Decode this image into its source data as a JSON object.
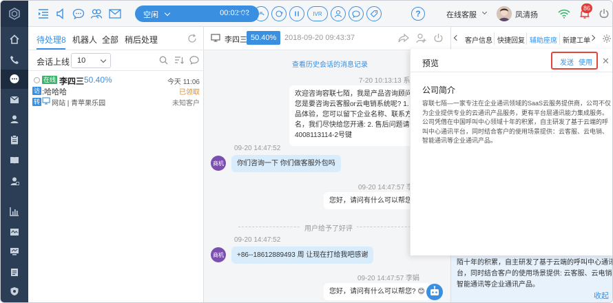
{
  "toolbar": {
    "status": "空闲",
    "timer": "00:02:02",
    "call_buttons": [
      "",
      "",
      "",
      "",
      "IVR",
      "",
      "",
      ""
    ],
    "service_mode": "在线客服",
    "user_name": "凤清扬",
    "notification_count": "86"
  },
  "left": {
    "tabs": [
      "待处理8",
      "机器人",
      "全部",
      "稍后处理"
    ],
    "filter_label": "会话上线",
    "filter_value": "10",
    "session": {
      "status_tag": "在线",
      "name": "李四三",
      "percent": "50.40%",
      "time": "今天 11:06",
      "visit_tag": "访",
      "message": ":哈哈哈",
      "claim": "已领取",
      "transfer_tag": "转",
      "source": "网站 | 青苹果乐园",
      "customer": "未知客户"
    }
  },
  "chat": {
    "name": "李四三",
    "percent": "50.40%",
    "time": "2018-09-20 09:43:37",
    "history_link": "查看历史会话的消息记录",
    "msg1_time": "7-20  10:13:13  系",
    "msg1_lines": [
      "欢迎咨询容联七陌，我是产品咨询顾问，请",
      "您是要咨询云客服or云电销系统呢? 1. 如需",
      "品体验，您可以留下企业名称、联系方式及",
      "名，我们尽快给您开通: 2. 售后问题请联系",
      "4008113114-2号键"
    ],
    "msg2_time": "09-20  14:47:52",
    "msg2_sender": "商机",
    "msg2_text": "你们咨询一下 你们做客服外包吗",
    "msg3_time": "09-20  14:47:57  李",
    "msg3_text": "您好，请问有什么可以帮您? ",
    "separator": "用户给予了好评",
    "msg4_time": "09-20  14:47:52",
    "msg4_sender": "商机",
    "msg4_text": "+86--18612889493 周 让现在打给我吧感谢",
    "msg5_time": "09-20  14:47:57  李娟",
    "msg5_text": "您好，请问有什么可以帮您? 😊"
  },
  "right": {
    "tabs": [
      "客户信息",
      "快捷回复",
      "辅助座席",
      "新建工单"
    ],
    "info_lines": [
      "陌十年的积累，自主研发了基于云端的呼叫中心通讯平",
      "台，同时结合客户的使用场景提供: 云客服、云电销、",
      "智能通讯等企业通讯产品。"
    ],
    "collapse": "收起"
  },
  "preview": {
    "title": "预览",
    "send": "发送",
    "use": "使用",
    "close": "✕",
    "heading": "公司简介",
    "body_lines": [
      "容联七陌—一家专注在企业通讯领域的SaaS云服务提供商，公司不仅",
      "为企业提供专业的云通讯产品服务，更有平台层通讯能力集成服务。",
      "公司凭借在中国呼叫中心领域十年的积累，自主研发了基于云端的呼",
      "叫中心通讯平台，同时结合客户的使用场景提供：云客服、云电销、",
      "智能通讯等企业通讯产品。"
    ]
  },
  "colors": {
    "accent": "#3b8fe0",
    "rail": "#2c3e55",
    "highlight": "#e0443a"
  }
}
